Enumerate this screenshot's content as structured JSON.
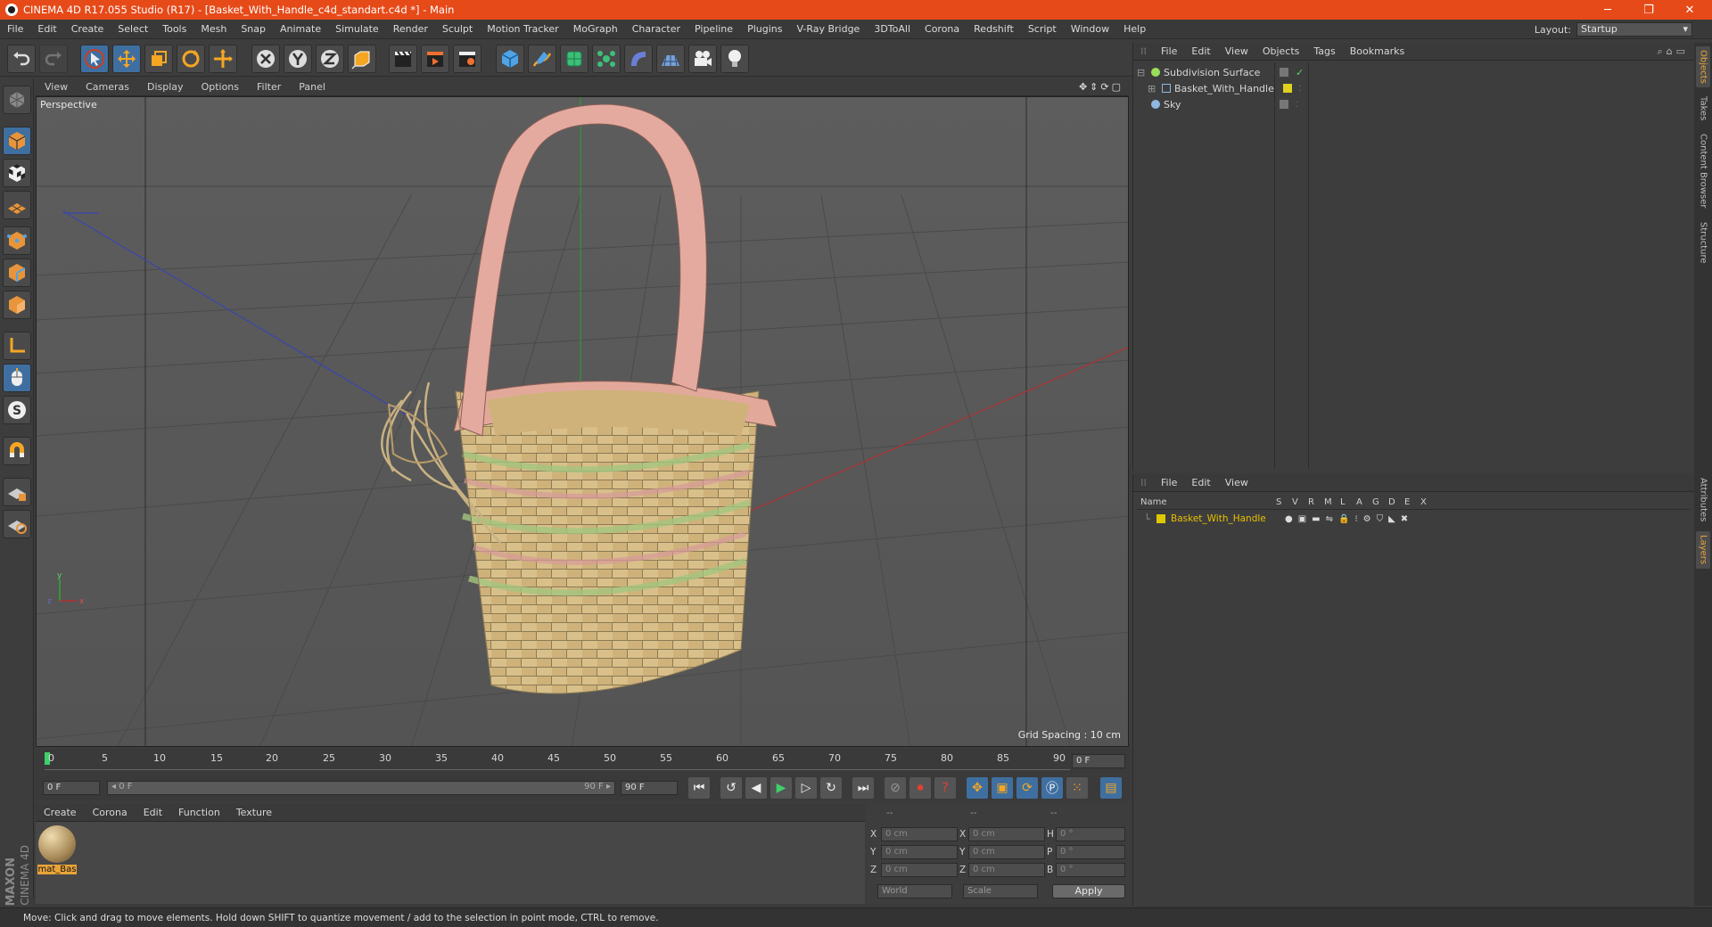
{
  "window": {
    "title": "CINEMA 4D R17.055 Studio (R17) - [Basket_With_Handle_c4d_standart.c4d *] - Main",
    "minimize": "─",
    "restore": "❐",
    "close": "✕"
  },
  "menu": [
    "File",
    "Edit",
    "Create",
    "Select",
    "Tools",
    "Mesh",
    "Snap",
    "Animate",
    "Simulate",
    "Render",
    "Sculpt",
    "Motion Tracker",
    "MoGraph",
    "Character",
    "Pipeline",
    "Plugins",
    "V-Ray Bridge",
    "3DToAll",
    "Corona",
    "Redshift",
    "Script",
    "Window",
    "Help"
  ],
  "layout": {
    "label": "Layout:",
    "value": "Startup"
  },
  "viewport": {
    "menu": [
      "View",
      "Cameras",
      "Display",
      "Options",
      "Filter",
      "Panel"
    ],
    "label": "Perspective",
    "grid_spacing": "Grid Spacing : 10 cm"
  },
  "timeline": {
    "ticks": [
      "0",
      "5",
      "10",
      "15",
      "20",
      "25",
      "30",
      "35",
      "40",
      "45",
      "50",
      "55",
      "60",
      "65",
      "70",
      "75",
      "80",
      "85",
      "90"
    ],
    "current_frame": "0 F",
    "start_field": "0 F",
    "range_start": "◂ 0 F",
    "range_end": "90 F ▸",
    "end_field": "90 F"
  },
  "material_manager": {
    "menu": [
      "Create",
      "Corona",
      "Edit",
      "Function",
      "Texture"
    ],
    "materials": [
      {
        "name": "mat_Bas"
      }
    ]
  },
  "coordinates": {
    "headers": [
      "--",
      "--",
      "--"
    ],
    "rows": [
      {
        "l1": "X",
        "v1": "0 cm",
        "l2": "X",
        "v2": "0 cm",
        "l3": "H",
        "v3": "0 °"
      },
      {
        "l1": "Y",
        "v1": "0 cm",
        "l2": "Y",
        "v2": "0 cm",
        "l3": "P",
        "v3": "0 °"
      },
      {
        "l1": "Z",
        "v1": "0 cm",
        "l2": "Z",
        "v2": "0 cm",
        "l3": "B",
        "v3": "0 °"
      }
    ],
    "space": "World",
    "mode": "Scale",
    "apply": "Apply"
  },
  "object_manager": {
    "menu": [
      "File",
      "Edit",
      "View",
      "Objects",
      "Tags",
      "Bookmarks"
    ],
    "objects": [
      {
        "name": "Subdivision Surface",
        "color": "#9adf5a"
      },
      {
        "name": "Basket_With_Handle",
        "color": "#e0c050"
      },
      {
        "name": "Sky",
        "color": "#8fb7e0"
      }
    ]
  },
  "layer_manager": {
    "menu": [
      "File",
      "Edit",
      "View"
    ],
    "columns": [
      "Name",
      "S",
      "V",
      "R",
      "M",
      "L",
      "A",
      "G",
      "D",
      "E",
      "X"
    ],
    "layers": [
      {
        "name": "Basket_With_Handle",
        "color": "#e0c800"
      }
    ]
  },
  "side_tabs": [
    "Objects",
    "Takes",
    "Content Browser",
    "Structure",
    "Attributes",
    "Layers"
  ],
  "brand": {
    "maxon": "MAXON",
    "product": "CINEMA 4D"
  },
  "status": "Move: Click and drag to move elements. Hold down SHIFT to quantize movement / add to the selection in point mode, CTRL to remove.",
  "colors": {
    "titlebar": "#e64a19",
    "accent": "#e8a43a",
    "selected_layer_text": "#e8c000"
  }
}
